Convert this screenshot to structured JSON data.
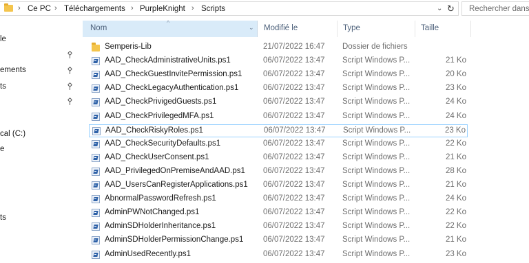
{
  "address_bar": {
    "crumbs": [
      "Ce PC",
      "Téléchargements",
      "PurpleKnight",
      "Scripts"
    ],
    "separator": "›",
    "dropdown_glyph": "⌄",
    "refresh_glyph": "↻"
  },
  "search": {
    "placeholder": "Rechercher dans :"
  },
  "nav_pane": {
    "items": [
      "le",
      "ements",
      "ts",
      "cal (C:)",
      "e",
      "ts"
    ]
  },
  "columns": {
    "name": "Nom",
    "modified": "Modifié le",
    "type": "Type",
    "size": "Taille"
  },
  "files": [
    {
      "name": "Semperis-Lib",
      "modified": "21/07/2022 16:47",
      "type": "Dossier de fichiers",
      "size": "",
      "icon": "folder-icon"
    },
    {
      "name": "AAD_CheckAdministrativeUnits.ps1",
      "modified": "06/07/2022 13:47",
      "type": "Script Windows P...",
      "size": "21 Ko",
      "icon": "powershell-script-icon"
    },
    {
      "name": "AAD_CheckGuestInvitePermission.ps1",
      "modified": "06/07/2022 13:47",
      "type": "Script Windows P...",
      "size": "20 Ko",
      "icon": "powershell-script-icon"
    },
    {
      "name": "AAD_CheckLegacyAuthentication.ps1",
      "modified": "06/07/2022 13:47",
      "type": "Script Windows P...",
      "size": "23 Ko",
      "icon": "powershell-script-icon"
    },
    {
      "name": "AAD_CheckPrivigedGuests.ps1",
      "modified": "06/07/2022 13:47",
      "type": "Script Windows P...",
      "size": "24 Ko",
      "icon": "powershell-script-icon"
    },
    {
      "name": "AAD_CheckPrivilegedMFA.ps1",
      "modified": "06/07/2022 13:47",
      "type": "Script Windows P...",
      "size": "24 Ko",
      "icon": "powershell-script-icon"
    },
    {
      "name": "AAD_CheckRiskyRoles.ps1",
      "modified": "06/07/2022 13:47",
      "type": "Script Windows P...",
      "size": "23 Ko",
      "icon": "powershell-script-icon",
      "selected": true
    },
    {
      "name": "AAD_CheckSecurityDefaults.ps1",
      "modified": "06/07/2022 13:47",
      "type": "Script Windows P...",
      "size": "22 Ko",
      "icon": "powershell-script-icon"
    },
    {
      "name": "AAD_CheckUserConsent.ps1",
      "modified": "06/07/2022 13:47",
      "type": "Script Windows P...",
      "size": "21 Ko",
      "icon": "powershell-script-icon"
    },
    {
      "name": "AAD_PrivilegedOnPremiseAndAAD.ps1",
      "modified": "06/07/2022 13:47",
      "type": "Script Windows P...",
      "size": "28 Ko",
      "icon": "powershell-script-icon"
    },
    {
      "name": "AAD_UsersCanRegisterApplications.ps1",
      "modified": "06/07/2022 13:47",
      "type": "Script Windows P...",
      "size": "21 Ko",
      "icon": "powershell-script-icon"
    },
    {
      "name": "AbnormalPasswordRefresh.ps1",
      "modified": "06/07/2022 13:47",
      "type": "Script Windows P...",
      "size": "24 Ko",
      "icon": "powershell-script-icon"
    },
    {
      "name": "AdminPWNotChanged.ps1",
      "modified": "06/07/2022 13:47",
      "type": "Script Windows P...",
      "size": "22 Ko",
      "icon": "powershell-script-icon"
    },
    {
      "name": "AdminSDHolderInheritance.ps1",
      "modified": "06/07/2022 13:47",
      "type": "Script Windows P...",
      "size": "22 Ko",
      "icon": "powershell-script-icon"
    },
    {
      "name": "AdminSDHolderPermissionChange.ps1",
      "modified": "06/07/2022 13:47",
      "type": "Script Windows P...",
      "size": "21 Ko",
      "icon": "powershell-script-icon"
    },
    {
      "name": "AdminUsedRecently.ps1",
      "modified": "06/07/2022 13:47",
      "type": "Script Windows P...",
      "size": "23 Ko",
      "icon": "powershell-script-icon"
    }
  ],
  "colors": {
    "header_selected_bg": "#d9ebf9",
    "selection_border": "#99d1ff",
    "folder": "#f4c54d"
  }
}
